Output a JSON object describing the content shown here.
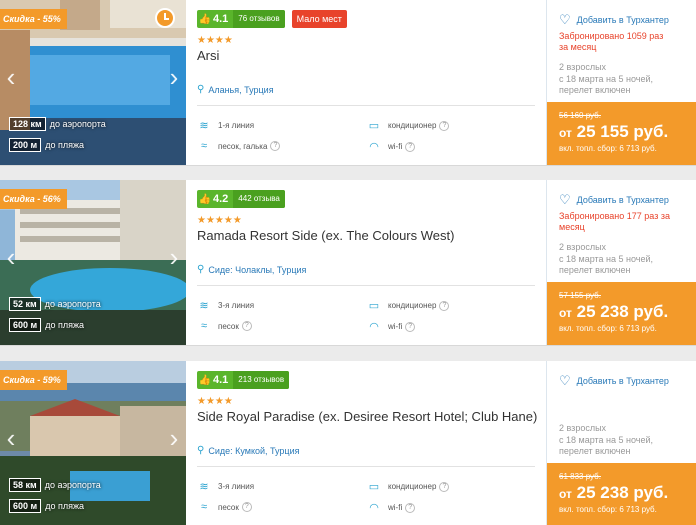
{
  "labels": {
    "to_airport": "до аэропорта",
    "to_beach": "до пляжа",
    "favorite": "Добавить в Турхантер",
    "price_prefix": "от",
    "fee": "вкл. топл. сбор: 6 713 руб."
  },
  "hotels": [
    {
      "discount": "Скидка - 55%",
      "airport_dist": "128 км",
      "beach_dist": "200 м",
      "score": "4.1",
      "reviews": "76 отзывов",
      "badge": "Мало мест",
      "stars": "★★★★",
      "name": "Arsi",
      "location": "Аланья, Турция",
      "line": "1-я линия",
      "beach_type": "песок, галька",
      "ac": "кондиционер",
      "wifi": "wi-fi",
      "booked": "Забронировано 1059 раз за месяц",
      "party": "2 взрослых",
      "dates": "с 18 марта на 5 ночей,",
      "flight": "перелет включен",
      "old_price": "56 160 руб.",
      "price": "25 155 руб."
    },
    {
      "discount": "Скидка - 56%",
      "airport_dist": "52 км",
      "beach_dist": "600 м",
      "score": "4.2",
      "reviews": "442 отзыва",
      "badge": "",
      "stars": "★★★★★",
      "name": "Ramada Resort Side (ex. The Colours West)",
      "location": "Сиде: Чолаклы, Турция",
      "line": "3-я линия",
      "beach_type": "песок",
      "ac": "кондиционер",
      "wifi": "wi-fi",
      "booked": "Забронировано 177 раз за месяц",
      "party": "2 взрослых",
      "dates": "с 18 марта на 5 ночей,",
      "flight": "перелет включен",
      "old_price": "57 155 руб.",
      "price": "25 238 руб."
    },
    {
      "discount": "Скидка - 59%",
      "airport_dist": "58 км",
      "beach_dist": "600 м",
      "score": "4.1",
      "reviews": "213 отзывов",
      "badge": "",
      "stars": "★★★★",
      "name": "Side Royal Paradise (ex. Desiree Resort Hotel; Club Hane)",
      "location": "Сиде: Кумкой, Турция",
      "line": "3-я линия",
      "beach_type": "песок",
      "ac": "кондиционер",
      "wifi": "wi-fi",
      "booked": "",
      "party": "2 взрослых",
      "dates": "с 18 марта на 5 ночей,",
      "flight": "перелет включен",
      "old_price": "61 833 руб.",
      "price": "25 238 руб."
    }
  ]
}
